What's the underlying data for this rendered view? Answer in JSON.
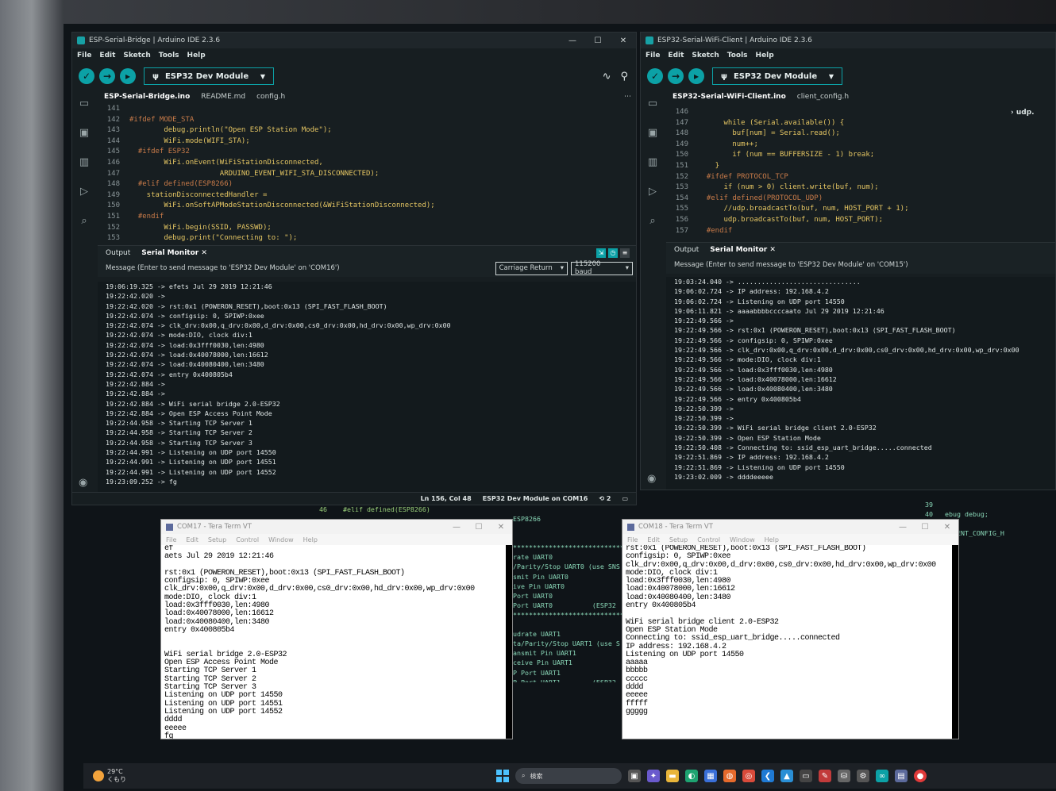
{
  "ide_left": {
    "title": "ESP-Serial-Bridge | Arduino IDE 2.3.6",
    "menu": [
      "File",
      "Edit",
      "Sketch",
      "Tools",
      "Help"
    ],
    "board": "ESP32 Dev Module",
    "tabs": [
      "ESP-Serial-Bridge.ino",
      "README.md",
      "config.h"
    ],
    "code": [
      {
        "n": "141",
        "t": ""
      },
      {
        "n": "142",
        "t": "#ifdef MODE_STA"
      },
      {
        "n": "143",
        "t": "        debug.println(\"Open ESP Station Mode\");"
      },
      {
        "n": "144",
        "t": "        WiFi.mode(WIFI_STA);"
      },
      {
        "n": "145",
        "t": "  #ifdef ESP32"
      },
      {
        "n": "146",
        "t": "        WiFi.onEvent(WiFiStationDisconnected,"
      },
      {
        "n": "147",
        "t": "                     ARDUINO_EVENT_WIFI_STA_DISCONNECTED);"
      },
      {
        "n": "148",
        "t": "  #elif defined(ESP8266)"
      },
      {
        "n": "149",
        "t": "    stationDisconnectedHandler ="
      },
      {
        "n": "150",
        "t": "        WiFi.onSoftAPModeStationDisconnected(&WiFiStationDisconnected);"
      },
      {
        "n": "151",
        "t": "  #endif"
      },
      {
        "n": "152",
        "t": "        WiFi.begin(SSID, PASSWD);"
      },
      {
        "n": "153",
        "t": "        debug.print(\"Connecting to: \");"
      }
    ],
    "panel_tabs": [
      "Output",
      "Serial Monitor"
    ],
    "message_placeholder": "Message (Enter to send message to 'ESP32 Dev Module' on 'COM16')",
    "line_ending": "Carriage Return",
    "baud": "115200 baud",
    "serial_lines": [
      "19:06:19.325 -> efets Jul 29 2019 12:21:46",
      "19:22:42.020 ->",
      "19:22:42.020 -> rst:0x1 (POWERON_RESET),boot:0x13 (SPI_FAST_FLASH_BOOT)",
      "19:22:42.074 -> configsip: 0, SPIWP:0xee",
      "19:22:42.074 -> clk_drv:0x00,q_drv:0x00,d_drv:0x00,cs0_drv:0x00,hd_drv:0x00,wp_drv:0x00",
      "19:22:42.074 -> mode:DIO, clock div:1",
      "19:22:42.074 -> load:0x3fff0030,len:4980",
      "19:22:42.074 -> load:0x40078000,len:16612",
      "19:22:42.074 -> load:0x40080400,len:3480",
      "19:22:42.074 -> entry 0x400805b4",
      "19:22:42.884 ->",
      "19:22:42.884 ->",
      "19:22:42.884 -> WiFi serial bridge 2.0-ESP32",
      "19:22:42.884 -> Open ESP Access Point Mode",
      "19:22:44.958 -> Starting TCP Server 1",
      "19:22:44.958 -> Starting TCP Server 2",
      "19:22:44.958 -> Starting TCP Server 3",
      "19:22:44.991 -> Listening on UDP port 14550",
      "19:22:44.991 -> Listening on UDP port 14551",
      "19:22:44.991 -> Listening on UDP port 14552",
      "19:23:09.252 -> fg"
    ],
    "status": [
      "Ln 156, Col 48",
      "ESP32 Dev Module on COM16",
      "2"
    ]
  },
  "ide_right": {
    "title": "ESP32-Serial-WiFi-Client | Arduino IDE 2.3.6",
    "menu": [
      "File",
      "Edit",
      "Sketch",
      "Tools",
      "Help"
    ],
    "board": "ESP32 Dev Module",
    "tabs": [
      "ESP32-Serial-WiFi-Client.ino",
      "client_config.h"
    ],
    "outline": "udp.",
    "code": [
      {
        "n": "146",
        "t": ""
      },
      {
        "n": "147",
        "t": "      while (Serial.available()) {"
      },
      {
        "n": "148",
        "t": "        buf[num] = Serial.read();"
      },
      {
        "n": "149",
        "t": "        num++;"
      },
      {
        "n": "150",
        "t": "        if (num == BUFFERSIZE - 1) break;"
      },
      {
        "n": "151",
        "t": "    }"
      },
      {
        "n": "152",
        "t": "  #ifdef PROTOCOL_TCP"
      },
      {
        "n": "153",
        "t": "      if (num > 0) client.write(buf, num);"
      },
      {
        "n": "154",
        "t": "  #elif defined(PROTOCOL_UDP)"
      },
      {
        "n": "155",
        "t": "      //udp.broadcastTo(buf, num, HOST_PORT + 1);"
      },
      {
        "n": "156",
        "t": "      udp.broadcastTo(buf, num, HOST_PORT);"
      },
      {
        "n": "157",
        "t": "  #endif"
      }
    ],
    "panel_tabs": [
      "Output",
      "Serial Monitor"
    ],
    "message_placeholder": "Message (Enter to send message to 'ESP32 Dev Module' on 'COM15')",
    "serial_lines": [
      "19:03:24.040 -> ...............................",
      "19:06:02.724 -> IP address: 192.168.4.2",
      "19:06:02.724 -> Listening on UDP port 14550",
      "19:06:11.821 -> aaaabbbbccccaato Jul 29 2019 12:21:46",
      "19:22:49.566 ->",
      "19:22:49.566 -> rst:0x1 (POWERON_RESET),boot:0x13 (SPI_FAST_FLASH_BOOT)",
      "19:22:49.566 -> configsip: 0, SPIWP:0xee",
      "19:22:49.566 -> clk_drv:0x00,q_drv:0x00,d_drv:0x00,cs0_drv:0x00,hd_drv:0x00,wp_drv:0x00",
      "19:22:49.566 -> mode:DIO, clock div:1",
      "19:22:49.566 -> load:0x3fff0030,len:4980",
      "19:22:49.566 -> load:0x40078000,len:16612",
      "19:22:49.566 -> load:0x40080400,len:3480",
      "19:22:49.566 -> entry 0x400805b4",
      "19:22:50.399 ->",
      "19:22:50.399 ->",
      "19:22:50.399 -> WiFi serial bridge client 2.0-ESP32",
      "19:22:50.399 -> Open ESP Station Mode",
      "19:22:50.408 -> Connecting to: ssid_esp_uart_bridge.....connected",
      "19:22:51.869 -> IP address: 192.168.4.2",
      "19:22:51.869 -> Listening on UDP port 14550",
      "19:23:02.009 -> ddddeeeee"
    ]
  },
  "bg_middle": {
    "code_line": "46    #elif defined(ESP8266)",
    "lines": [
      "ESP8266",
      "",
      "",
      "****************************",
      "rate UART0",
      "/Parity/Stop UART0 (use SNS",
      "smit Pin UART0",
      "ive Pin UART0",
      "Port UART0",
      "Port UART0          (ESP32",
      "****************************",
      "",
      "udrate UART1",
      "ta/Parity/Stop UART1 (use S",
      "ansmit Pin UART1",
      "ceive Pin UART1",
      "P Port UART1",
      "P Port UART1        (ESP32"
    ]
  },
  "bg_right": {
    "lines": [
      "39",
      "40   ebug debug;",
      "",
      "  // CLIENT_CONFIG_H"
    ]
  },
  "teraterm_left": {
    "title": "COM17 - Tera Term VT",
    "menu": [
      "File",
      "Edit",
      "Setup",
      "Control",
      "Window",
      "Help"
    ],
    "lines": [
      "ef",
      "aets Jul 29 2019 12:21:46",
      "",
      "rst:0x1 (POWERON_RESET),boot:0x13 (SPI_FAST_FLASH_BOOT)",
      "configsip: 0, SPIWP:0xee",
      "clk_drv:0x00,q_drv:0x00,d_drv:0x00,cs0_drv:0x00,hd_drv:0x00,wp_drv:0x00",
      "mode:DIO, clock div:1",
      "load:0x3fff0030,len:4980",
      "load:0x40078000,len:16612",
      "load:0x40080400,len:3480",
      "entry 0x400805b4",
      "",
      "",
      "WiFi serial bridge 2.0-ESP32",
      "Open ESP Access Point Mode",
      "Starting TCP Server 1",
      "Starting TCP Server 2",
      "Starting TCP Server 3",
      "Listening on UDP port 14550",
      "Listening on UDP port 14551",
      "Listening on UDP port 14552",
      "dddd",
      "eeeee",
      "fg"
    ]
  },
  "teraterm_right": {
    "title": "COM18 - Tera Term VT",
    "menu": [
      "File",
      "Edit",
      "Setup",
      "Control",
      "Window",
      "Help"
    ],
    "lines": [
      "rst:0x1 (POWERON_RESET),boot:0x13 (SPI_FAST_FLASH_BOOT)",
      "configsip: 0, SPIWP:0xee",
      "clk_drv:0x00,q_drv:0x00,d_drv:0x00,cs0_drv:0x00,hd_drv:0x00,wp_drv:0x00",
      "mode:DIO, clock div:1",
      "load:0x3fff0030,len:4980",
      "load:0x40078000,len:16612",
      "load:0x40080400,len:3480",
      "entry 0x400805b4",
      "",
      "WiFi serial bridge client 2.0-ESP32",
      "Open ESP Station Mode",
      "Connecting to: ssid_esp_uart_bridge.....connected",
      "IP address: 192.168.4.2",
      "Listening on UDP port 14550",
      "aaaaa",
      "bbbbb",
      "ccccc",
      "dddd",
      "eeeee",
      "fffff",
      "ggggg"
    ]
  },
  "taskbar": {
    "weather_temp": "29°C",
    "weather_desc": "くもり",
    "search_label": "検索"
  }
}
